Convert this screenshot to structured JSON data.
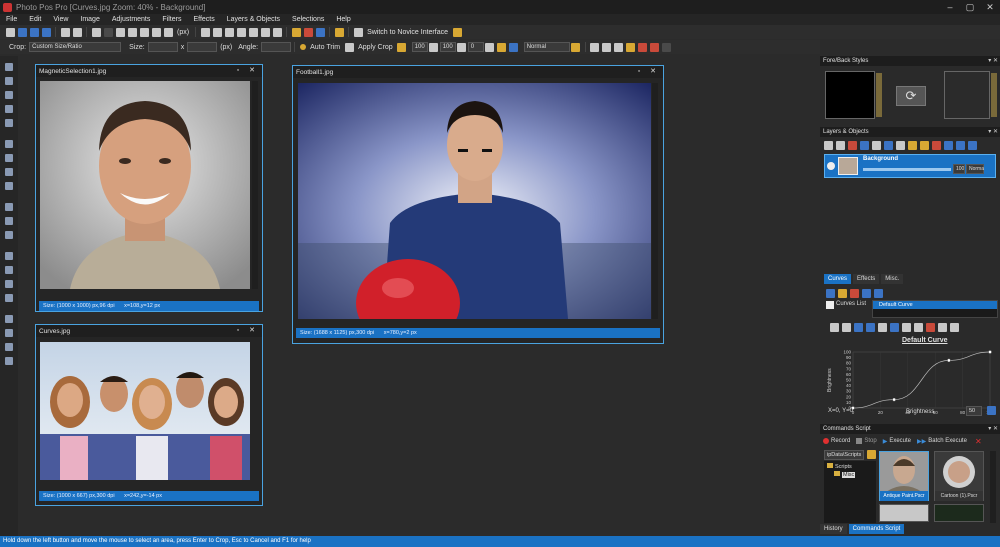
{
  "window": {
    "title": "Photo Pos Pro [Curves.jpg Zoom: 40% - Background]"
  },
  "menu": [
    "File",
    "Edit",
    "View",
    "Image",
    "Adjustments",
    "Filters",
    "Effects",
    "Layers & Objects",
    "Selections",
    "Help"
  ],
  "toolbar1": {
    "zoom_label": "(px)",
    "switch_label": "Switch to Novice Interface"
  },
  "toolbar2": {
    "crop_label": "Crop:",
    "crop_mode": "Custom Size/Ratio",
    "size_label": "Size:",
    "x_label": "x",
    "unit_label": "(px)",
    "angle_label": "Angle:",
    "auto_trim": "Auto Trim",
    "apply_crop": "Apply Crop",
    "opacity1": "100",
    "opacity2": "100",
    "value3": "0",
    "blend_mode": "Normal"
  },
  "documents": [
    {
      "title": "MagneticSelection1.jpg",
      "size": "Size: (1000 x 1000) px,96 dpi",
      "coords": "x=108,y=12 px"
    },
    {
      "title": "Football1.jpg",
      "size": "Size: (1688 x 1125) px,300 dpi",
      "coords": "x=780,y=2 px"
    },
    {
      "title": "Curves.jpg",
      "size": "Size: (1000 x 667) px,300 dpi",
      "coords": "x=242,y=-14 px"
    }
  ],
  "panels": {
    "foreback": {
      "title": "Fore/Back Styles"
    },
    "layers": {
      "title": "Layers & Objects",
      "layer_name": "Background",
      "opacity": "100",
      "blend": "Norma"
    },
    "curves_tabs": [
      "Curves",
      "Effects",
      "Misc."
    ],
    "curves": {
      "list_label": "Curves List",
      "list_item": "Default Curve",
      "chart_title": "Default Curve",
      "readout": "X=0, Y=0",
      "value": "50"
    },
    "commands": {
      "title": "Commands Script",
      "record": "Record",
      "stop": "Stop",
      "execute": "Execute",
      "batch": "Batch Execute",
      "path": "ipData\\Scripts",
      "folder_root": "Scripts",
      "folder_misc": "Misc",
      "thumb1": "Antique Paint.Pscr",
      "thumb2": "Cartoon (1).Pscr"
    },
    "bottom_tabs": [
      "History",
      "Commands Script"
    ]
  },
  "chart_data": {
    "type": "line",
    "title": "Default Curve",
    "xlabel": "Brightness",
    "ylabel": "Brightness",
    "xlim": [
      0,
      100
    ],
    "ylim": [
      0,
      100
    ],
    "x_ticks": [
      0,
      20,
      40,
      60,
      80,
      100
    ],
    "y_ticks": [
      0,
      10,
      20,
      30,
      40,
      50,
      60,
      70,
      80,
      90,
      100
    ],
    "series": [
      {
        "x": [
          0,
          30,
          70,
          100
        ],
        "y": [
          0,
          15,
          85,
          100
        ]
      }
    ]
  },
  "statusbar": {
    "text": "Hold down the left button and move the mouse to select an area, press Enter to Crop, Esc to Cancel and F1 for help"
  }
}
